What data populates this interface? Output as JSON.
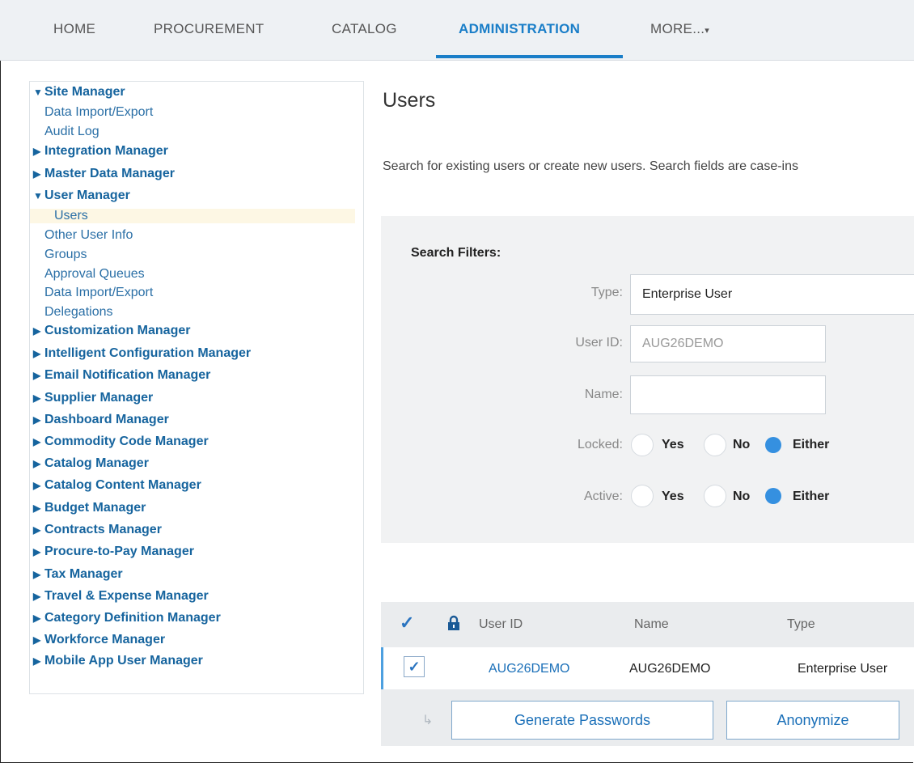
{
  "nav": {
    "tabs": [
      "HOME",
      "PROCUREMENT",
      "CATALOG",
      "ADMINISTRATION",
      "MORE..."
    ],
    "more_caret": "▾",
    "active": "ADMINISTRATION"
  },
  "sidebar": {
    "items": [
      {
        "label": "Site Manager",
        "kind": "section",
        "expanded": true
      },
      {
        "label": "Data Import/Export",
        "kind": "sub"
      },
      {
        "label": "Audit Log",
        "kind": "sub"
      },
      {
        "label": "Integration Manager",
        "kind": "section",
        "expanded": false
      },
      {
        "label": "Master Data Manager",
        "kind": "section",
        "expanded": false
      },
      {
        "label": "User Manager",
        "kind": "section",
        "expanded": true
      },
      {
        "label": "Users",
        "kind": "sub",
        "selected": true
      },
      {
        "label": "Other User Info",
        "kind": "sub"
      },
      {
        "label": "Groups",
        "kind": "sub"
      },
      {
        "label": "Approval Queues",
        "kind": "sub"
      },
      {
        "label": "Data Import/Export",
        "kind": "sub"
      },
      {
        "label": "Delegations",
        "kind": "sub"
      },
      {
        "label": "Customization Manager",
        "kind": "section",
        "expanded": false
      },
      {
        "label": "Intelligent Configuration Manager",
        "kind": "section",
        "expanded": false
      },
      {
        "label": "Email Notification Manager",
        "kind": "section",
        "expanded": false
      },
      {
        "label": "Supplier Manager",
        "kind": "section",
        "expanded": false
      },
      {
        "label": "Dashboard Manager",
        "kind": "section",
        "expanded": false
      },
      {
        "label": "Commodity Code Manager",
        "kind": "section",
        "expanded": false
      },
      {
        "label": "Catalog Manager",
        "kind": "section",
        "expanded": false
      },
      {
        "label": "Catalog Content Manager",
        "kind": "section",
        "expanded": false
      },
      {
        "label": "Budget Manager",
        "kind": "section",
        "expanded": false
      },
      {
        "label": "Contracts Manager",
        "kind": "section",
        "expanded": false
      },
      {
        "label": "Procure-to-Pay Manager",
        "kind": "section",
        "expanded": false
      },
      {
        "label": "Tax Manager",
        "kind": "section",
        "expanded": false
      },
      {
        "label": "Travel & Expense Manager",
        "kind": "section",
        "expanded": false
      },
      {
        "label": "Category Definition Manager",
        "kind": "section",
        "expanded": false
      },
      {
        "label": "Workforce Manager",
        "kind": "section",
        "expanded": false
      },
      {
        "label": "Mobile App User Manager",
        "kind": "section",
        "expanded": false
      }
    ],
    "arrow_expanded": "▼",
    "arrow_collapsed": "▶"
  },
  "main": {
    "title": "Users",
    "description": "Search for existing users or create new users.  Search fields are case-ins"
  },
  "filters": {
    "heading": "Search Filters:",
    "type_label": "Type:",
    "type_value": "Enterprise User",
    "userid_label": "User ID:",
    "userid_placeholder": "AUG26DEMO",
    "name_label": "Name:",
    "name_value": "",
    "locked_label": "Locked:",
    "active_label": "Active:",
    "options": [
      "Yes",
      "No",
      "Either"
    ],
    "locked_selected": "Either",
    "active_selected": "Either"
  },
  "table": {
    "headers": [
      "User ID",
      "Name",
      "Type"
    ],
    "rows": [
      {
        "user_id": "AUG26DEMO",
        "name": "AUG26DEMO",
        "type": "Enterprise User",
        "checked": true
      }
    ],
    "check_glyph": "✓"
  },
  "actions": {
    "generate_passwords": "Generate Passwords",
    "anonymize": "Anonymize",
    "return_glyph": "↳"
  },
  "colors": {
    "accent": "#1a7ec8",
    "link": "#16649e",
    "radio_on": "#3590e0"
  }
}
